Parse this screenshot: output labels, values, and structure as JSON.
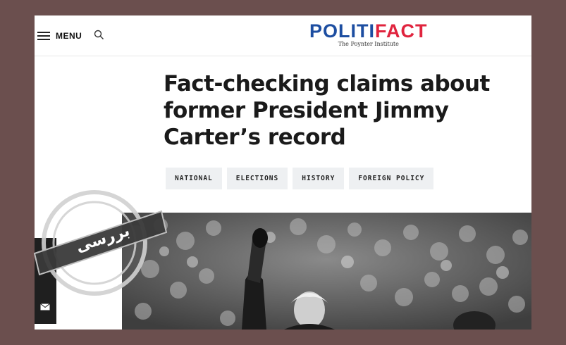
{
  "header": {
    "menu_label": "MENU",
    "logo_part1": "POLITI",
    "logo_part2": "FACT",
    "logo_sub": "The Poynter Institute"
  },
  "article": {
    "headline": "Fact-checking claims about former President Jimmy Carter’s record",
    "tags": [
      "NATIONAL",
      "ELECTIONS",
      "HISTORY",
      "FOREIGN POLICY"
    ]
  },
  "stamp": {
    "text": "بررسی"
  }
}
